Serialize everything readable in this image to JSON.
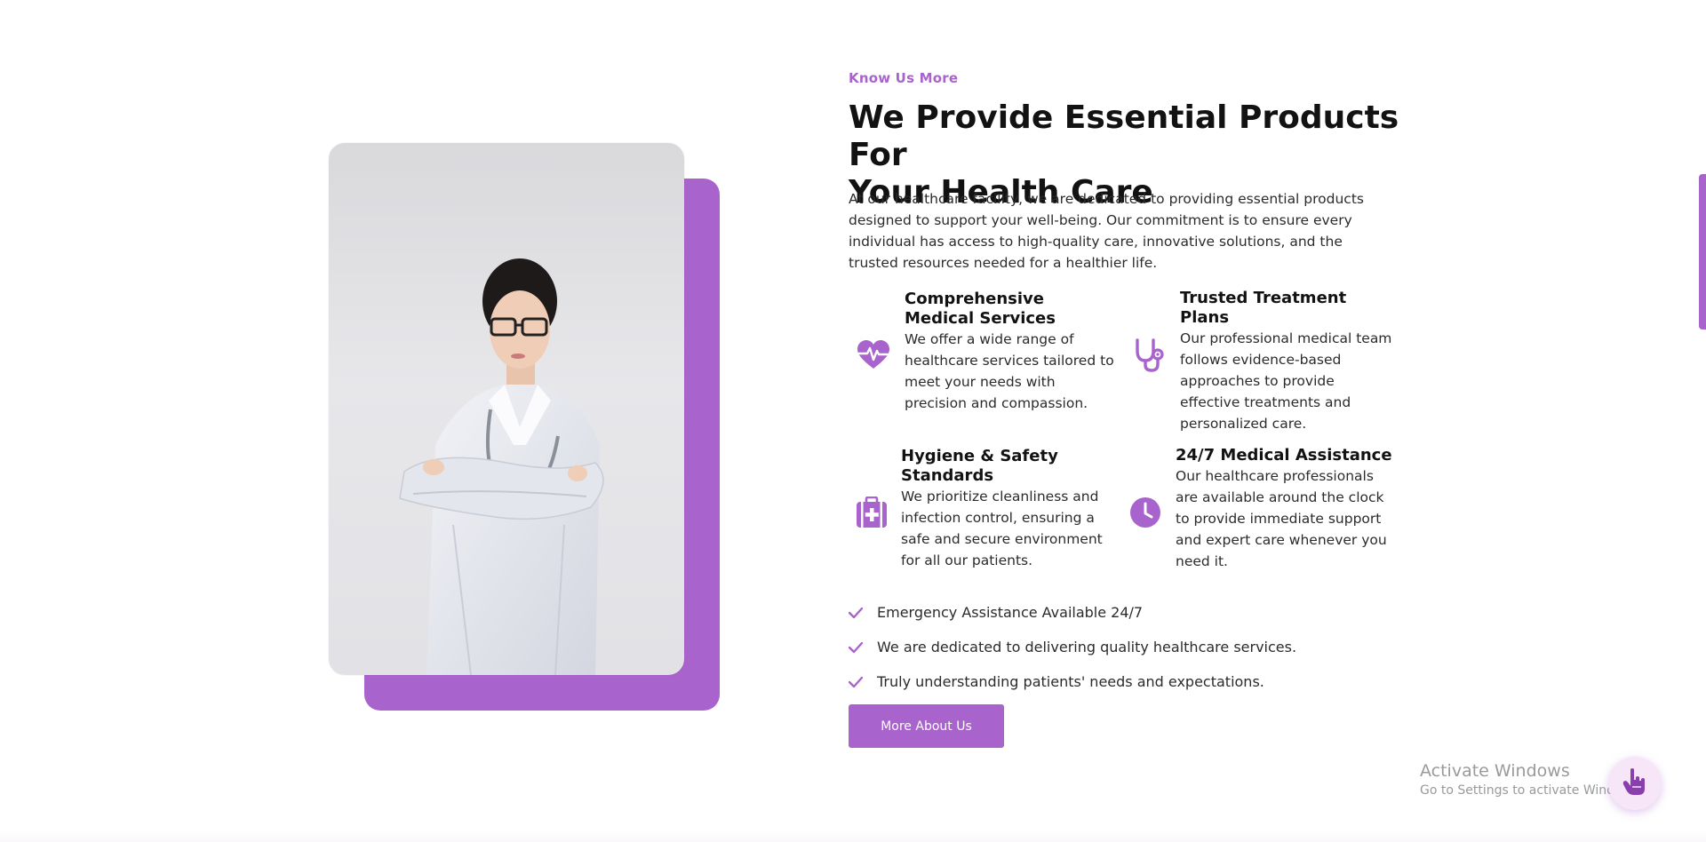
{
  "colors": {
    "accent": "#a963cc",
    "heading": "#121212",
    "text": "#2b2b2b"
  },
  "about": {
    "eyebrow": "Know Us More",
    "heading_line1": "We Provide Essential Products For",
    "heading_line2": "Your Health Care",
    "intro": "At our healthcare facility, we are dedicated to providing essential products designed to support your well-being. Our commitment is to ensure every individual has access to high-quality care, innovative solutions, and the trusted resources needed for a healthier life."
  },
  "features": [
    {
      "icon": "heartbeat-icon",
      "title": "Comprehensive Medical Services",
      "text": "We offer a wide range of healthcare services tailored to meet your needs with precision and compassion."
    },
    {
      "icon": "stethoscope-icon",
      "title": "Trusted Treatment Plans",
      "text": "Our professional medical team follows evidence-based approaches to provide effective treatments and personalized care."
    },
    {
      "icon": "medical-kit-icon",
      "title": "Hygiene & Safety Standards",
      "text": "We prioritize cleanliness and infection control, ensuring a safe and secure environment for all our patients."
    },
    {
      "icon": "clock-icon",
      "title": "24/7 Medical Assistance",
      "text": "Our healthcare professionals are available around the clock to provide immediate support and expert care whenever you need it."
    }
  ],
  "checklist": [
    "Emergency Assistance Available 24/7",
    "We are dedicated to delivering quality healthcare services.",
    "Truly understanding patients' needs and expectations."
  ],
  "cta": {
    "label": "More About Us"
  },
  "watermark": {
    "title": "Activate Windows",
    "subtitle": "Go to Settings to activate Windows."
  },
  "fab": {
    "icon": "hand-pointer-icon"
  }
}
